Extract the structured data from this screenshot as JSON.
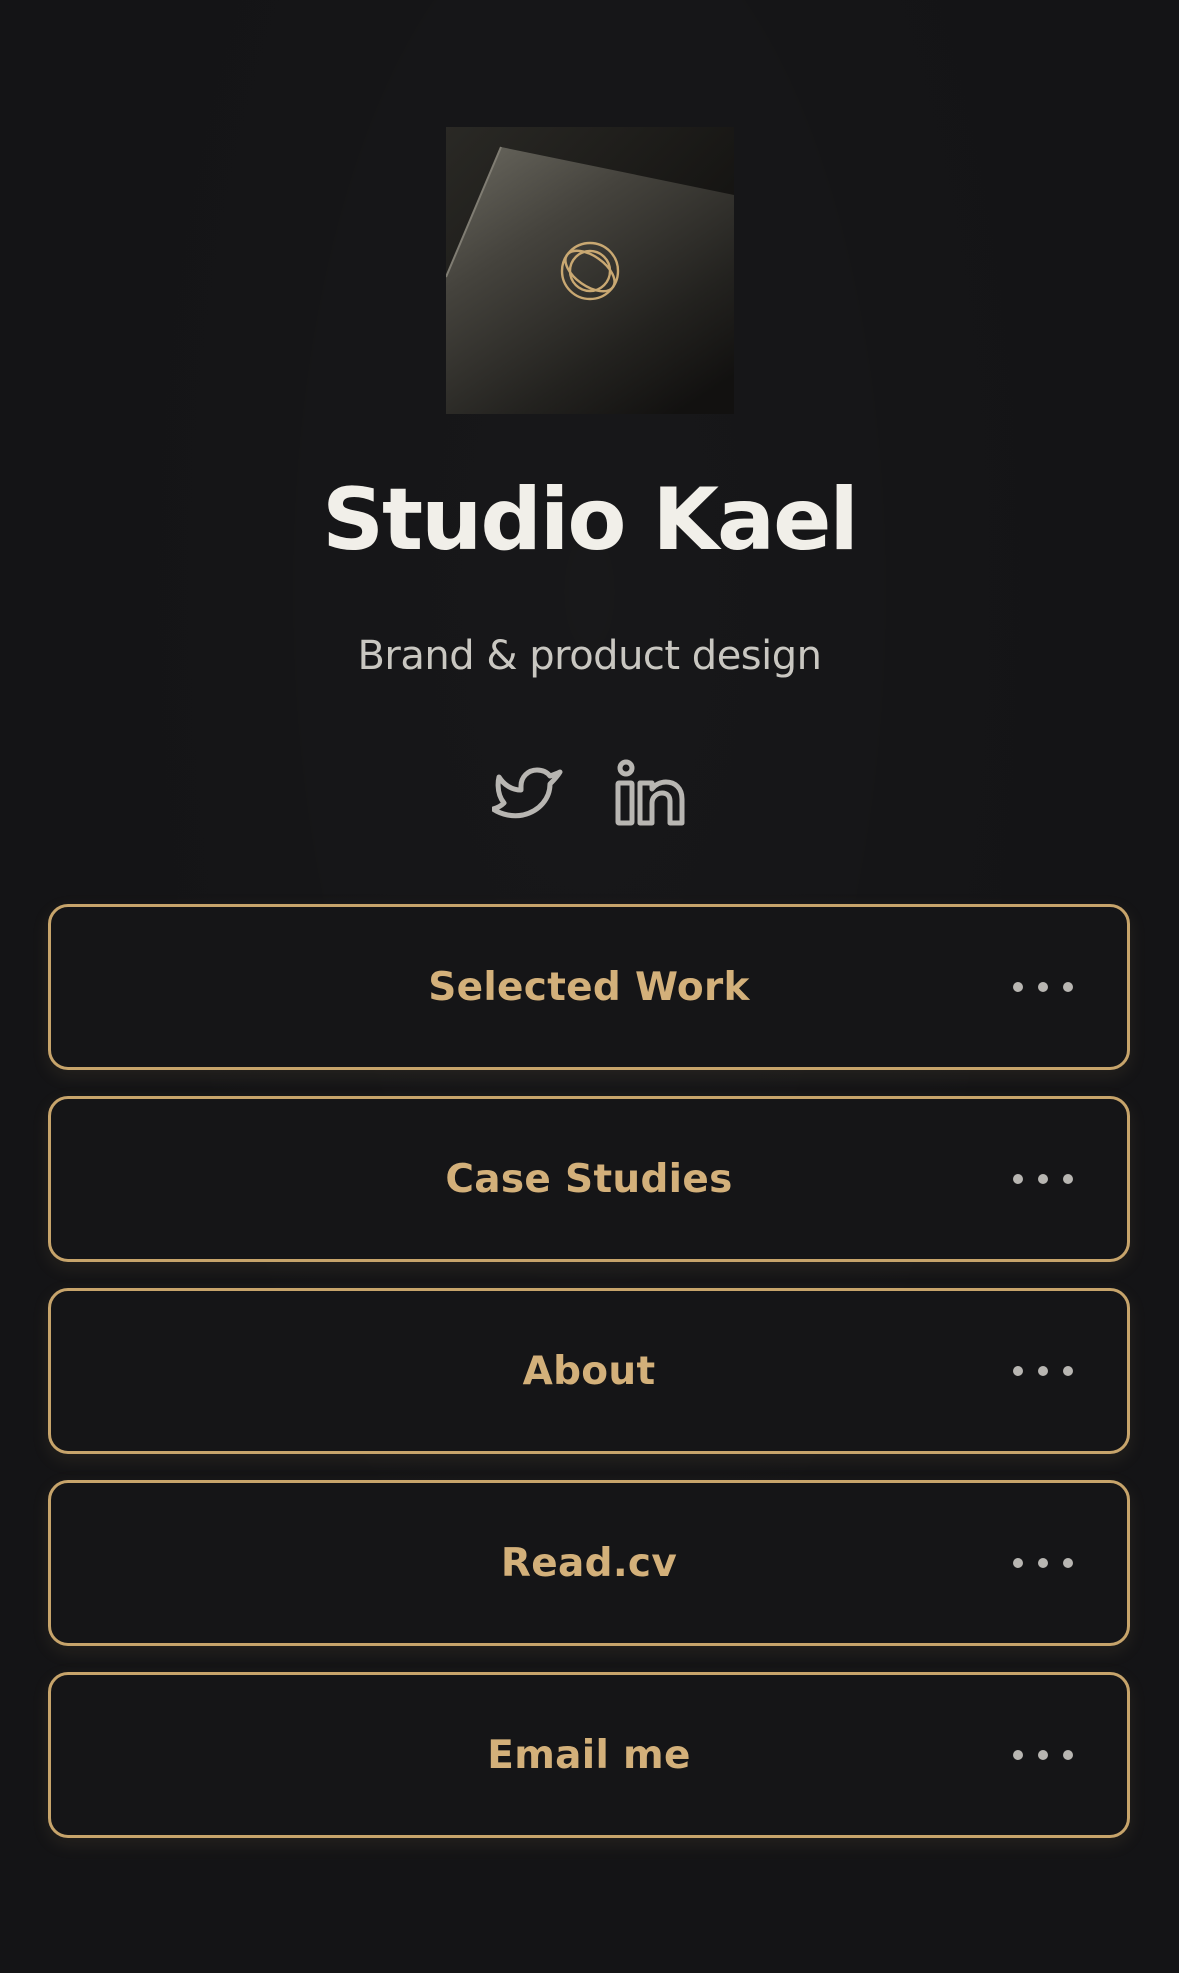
{
  "profile": {
    "name": "Studio Kael",
    "tagline": "Brand & product design",
    "avatar_icon": "gold-ring-logo-on-dark-card"
  },
  "socials": [
    {
      "icon": "twitter-icon"
    },
    {
      "icon": "linkedin-icon"
    }
  ],
  "links": [
    {
      "label": "Selected Work",
      "menu_icon": "more-icon"
    },
    {
      "label": "Case Studies",
      "menu_icon": "more-icon"
    },
    {
      "label": "About",
      "menu_icon": "more-icon"
    },
    {
      "label": "Read.cv",
      "menu_icon": "more-icon"
    },
    {
      "label": "Email me",
      "menu_icon": "more-icon"
    }
  ],
  "colors": {
    "background": "#141416",
    "accent": "#c7a46b",
    "title": "#f1efe9",
    "subtitle": "#c9c7c1",
    "icon": "#b8b6b2"
  }
}
